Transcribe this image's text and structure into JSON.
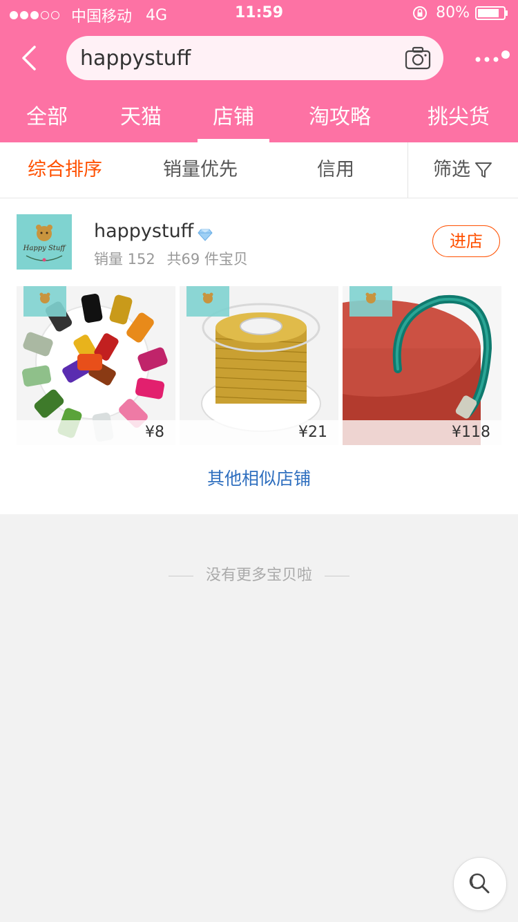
{
  "status_bar": {
    "carrier": "中国移动",
    "network": "4G",
    "time": "11:59",
    "battery": "80%"
  },
  "search": {
    "query": "happystuff"
  },
  "type_tabs": [
    {
      "label": "全部"
    },
    {
      "label": "天猫"
    },
    {
      "label": "店铺"
    },
    {
      "label": "淘攻略"
    },
    {
      "label": "挑尖货"
    }
  ],
  "sort_bar": {
    "items": [
      {
        "label": "综合排序"
      },
      {
        "label": "销量优先"
      },
      {
        "label": "信用"
      }
    ],
    "filter_label": "筛选"
  },
  "shop": {
    "name": "happystuff",
    "sales": "销量 152",
    "count": "共69 件宝贝",
    "enter_label": "进店",
    "logo_text": "Happy Stuff",
    "products": [
      {
        "price": "¥8"
      },
      {
        "price": "¥21"
      },
      {
        "price": "¥118"
      }
    ],
    "similar_label": "其他相似店铺"
  },
  "end_note": "没有更多宝贝啦",
  "colors": {
    "header": "#fd72a4",
    "accent": "#ff5000",
    "link": "#2f6fbf"
  }
}
